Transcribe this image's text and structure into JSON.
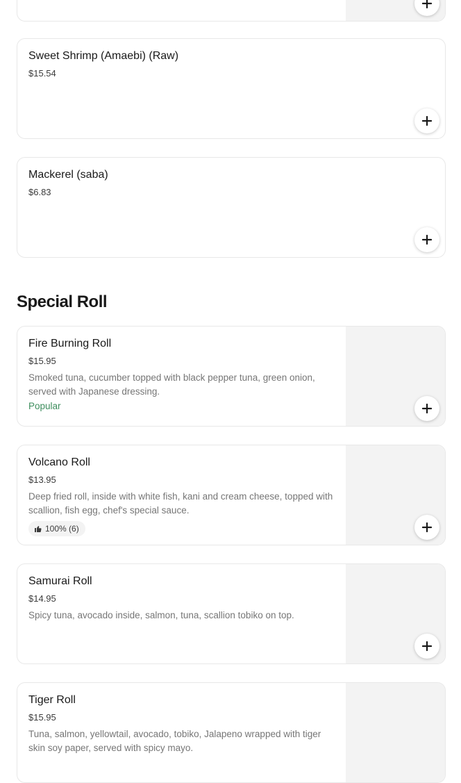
{
  "menu_items_top": [
    {
      "name": "Sweet Shrimp (Amaebi) (Raw)",
      "price": "$15.54"
    },
    {
      "name": "Mackerel (saba)",
      "price": "$6.83"
    }
  ],
  "special_roll": {
    "title": "Special Roll",
    "items": [
      {
        "name": "Fire Burning Roll",
        "price": "$15.95",
        "description": "Smoked tuna, cucumber topped with black pepper tuna, green onion, served with Japanese dressing.",
        "badge": "Popular"
      },
      {
        "name": "Volcano Roll",
        "price": "$13.95",
        "description": "Deep fried roll, inside with white fish, kani and cream cheese, topped with scallion, fish egg, chef's special sauce.",
        "rating": "100% (6)"
      },
      {
        "name": "Samurai Roll",
        "price": "$14.95",
        "description": "Spicy tuna, avocado inside, salmon, tuna, scallion tobiko on top."
      },
      {
        "name": "Tiger Roll",
        "price": "$15.95",
        "description": "Tuna, salmon, yellowtail, avocado, tobiko, Jalapeno wrapped with tiger skin soy paper, served with spicy mayo."
      }
    ]
  },
  "colors": {
    "popular": "#3e8e5e",
    "card_border": "#e8e8e8",
    "image_placeholder": "#f3f3f3"
  },
  "icons": {
    "add": "plus-icon",
    "rating": "thumbs-up-icon"
  }
}
